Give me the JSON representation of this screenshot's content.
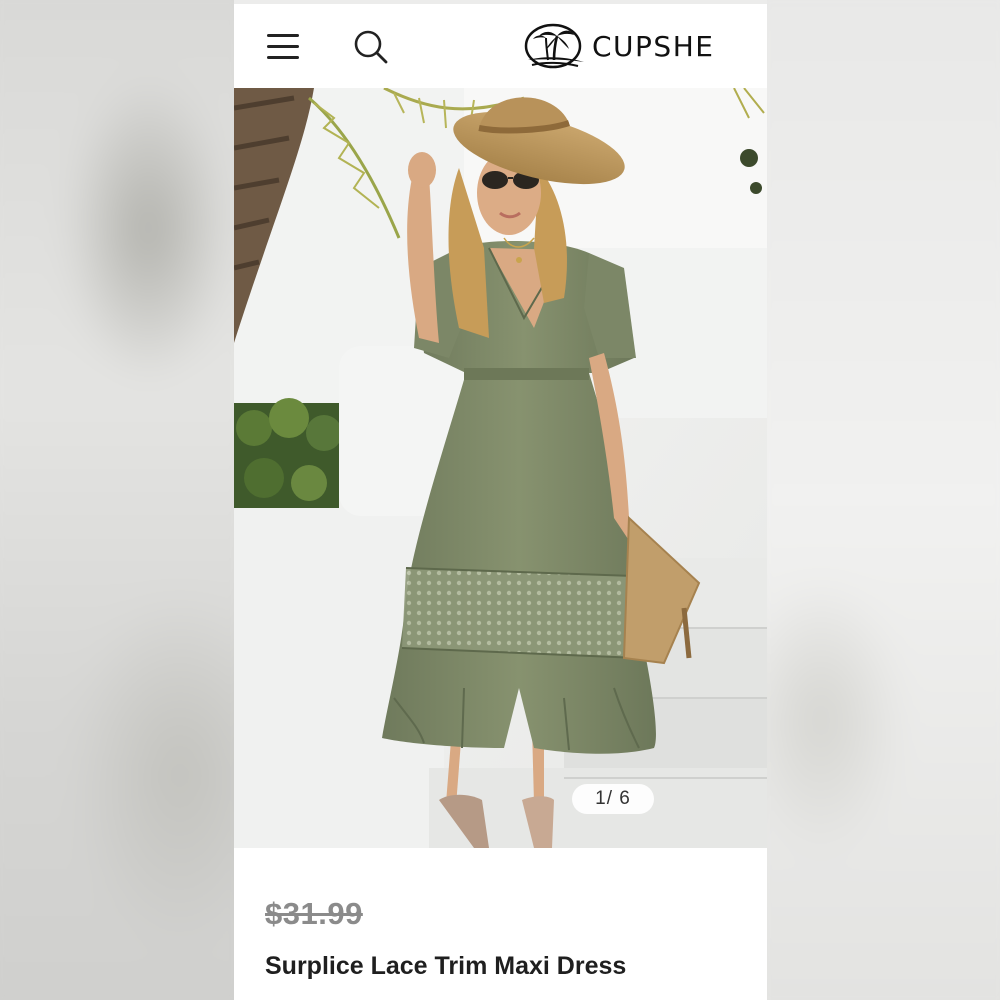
{
  "header": {
    "brand": "CUPSHE",
    "menu_icon": "hamburger-menu-icon",
    "search_icon": "search-icon",
    "logo_icon": "palm-tree-logo-icon"
  },
  "gallery": {
    "image_description": "woman in green lace trim maxi dress with straw hat",
    "pager": "1/ 6"
  },
  "product": {
    "old_price": "$31.99",
    "title": "Surplice Lace Trim Maxi Dress"
  },
  "colors": {
    "dress": "#7f8a6b",
    "background": "#ffffff",
    "text": "#1f1f1f",
    "strike_price": "#8b8b8b"
  }
}
